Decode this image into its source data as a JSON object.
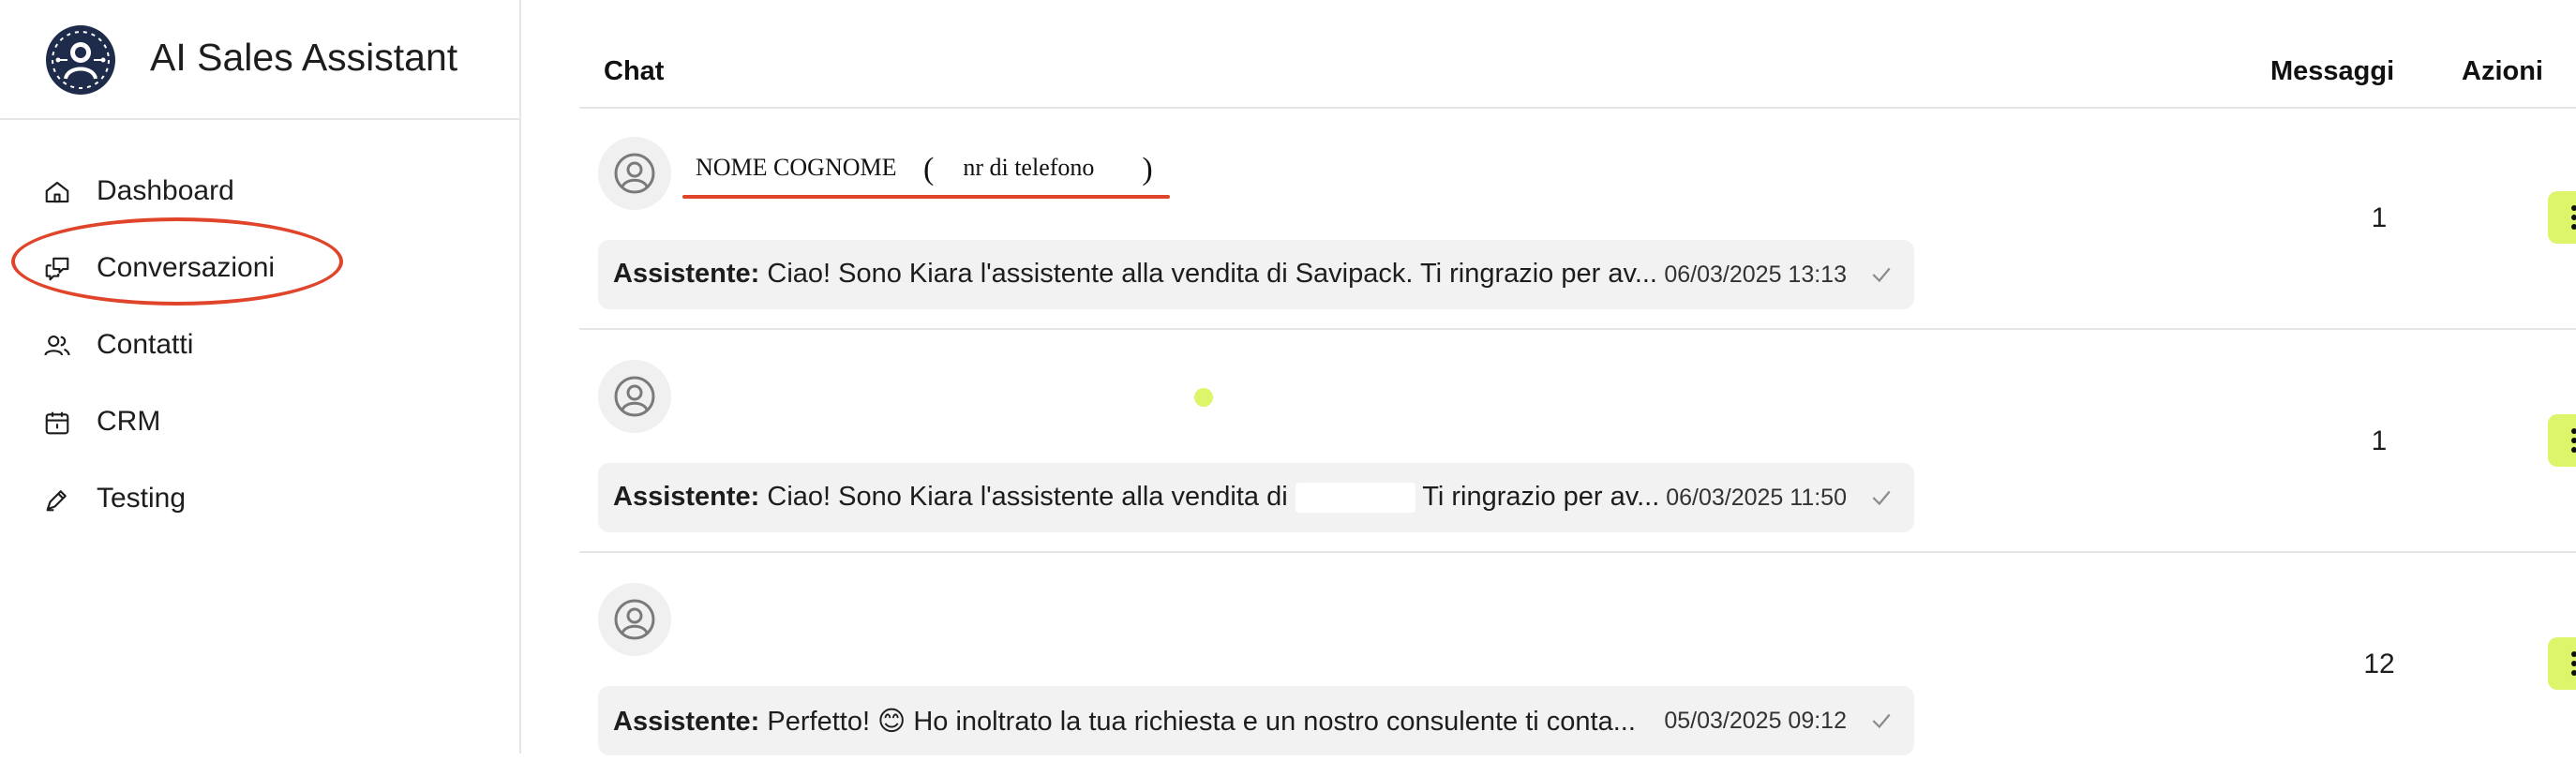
{
  "app": {
    "title": "AI Sales Assistant",
    "accent_color": "#dcf56a",
    "annotation_color": "#e0442a"
  },
  "sidebar": {
    "items": [
      {
        "label": "Dashboard",
        "icon": "home-icon"
      },
      {
        "label": "Conversazioni",
        "icon": "chat-bubbles-icon"
      },
      {
        "label": "Contatti",
        "icon": "users-icon"
      },
      {
        "label": "CRM",
        "icon": "calendar-icon"
      },
      {
        "label": "Testing",
        "icon": "pen-icon"
      }
    ]
  },
  "table": {
    "headers": {
      "chat": "Chat",
      "messages": "Messaggi",
      "actions": "Azioni"
    },
    "rows": [
      {
        "contact_name": "NOME COGNOME",
        "contact_phone": "nr di telefono",
        "sender": "Assistente:",
        "preview": "Ciao! Sono Kiara l'assistente alla vendita di Savipack. Ti ringrazio per av...",
        "timestamp": "06/03/2025 13:13",
        "messages": "1"
      },
      {
        "contact_name": "",
        "contact_phone": "",
        "sender": "Assistente:",
        "preview": "Ciao! Sono Kiara l'assistente alla vendita di ",
        "preview_tail": "Ti ringrazio per av...",
        "timestamp": "06/03/2025 11:50",
        "messages": "1"
      },
      {
        "contact_name": "",
        "contact_phone": "",
        "sender": "Assistente:",
        "preview": "Perfetto! 😊 Ho inoltrato la tua richiesta e un nostro consulente ti conta...",
        "timestamp": "05/03/2025 09:12",
        "messages": "12"
      }
    ]
  }
}
